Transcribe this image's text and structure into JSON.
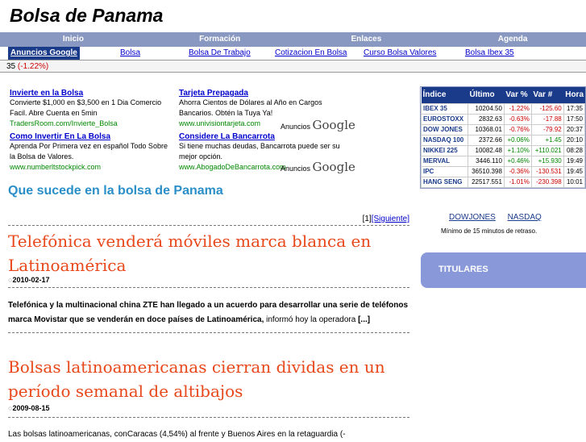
{
  "site_title": "Bolsa de Panama",
  "nav": [
    "Inicio",
    "Formación",
    "Enlaces",
    "Agenda"
  ],
  "subnav": {
    "ad_label": "Anuncios Google",
    "links": [
      "Bolsa",
      "Bolsa De Trabajo",
      "Cotizacion En Bolsa",
      "Curso Bolsa Valores",
      "Bolsa Ibex 35"
    ]
  },
  "ticker": {
    "prefix": "35",
    "value": "(-1.22%)"
  },
  "ads": [
    {
      "title": "Invierte en la Bolsa",
      "body": "Convierte $1,000 en $3,500 en 1 Dia Comercio Facil. Abre Cuenta en 5min",
      "url": "TradersRoom.com/Invierte_Bolsa"
    },
    {
      "title": "Tarjeta Prepagada",
      "body": "Ahorra Cientos de Dólares al Año en Cargos Bancarios. Obtén la Tuya Ya!",
      "url": "www.univisiontarjeta.com"
    },
    {
      "title": "Como Invertir En La Bolsa",
      "body": "Aprenda Por Primera vez en español Todo Sobre la Bolsa de Valores.",
      "url": "www.numberltstockpick.com"
    },
    {
      "title": "Considere La Bancarrota",
      "body": "Si tiene muchas deudas, Bancarrota puede ser su mejor opción.",
      "url": "www.AbogadoDeBancarrota.com"
    }
  ],
  "ads_by": {
    "label": "Anuncios",
    "brand": "Google"
  },
  "section_title": "Que sucede en la bolsa de Panama",
  "pager": {
    "current": "[1]",
    "next": "[Siguiente]"
  },
  "articles": [
    {
      "title": "Telefónica venderá móviles marca blanca en Latinoamérica",
      "date": "2010-02-17",
      "body_bold": "Telefónica y la multinacional china ZTE han llegado a un acuerdo para desarrollar una serie de teléfonos marca Movistar que se venderán en doce países de Latinoamérica,",
      "body_rest": " informó hoy la operadora ",
      "more": "[...]"
    },
    {
      "title": "Bolsas latinoamericanas cierran dividas en un período semanal de altibajos",
      "date": "2009-08-15",
      "body_rest": "Las bolsas latinoamericanas, conCaracas (4,54%) al frente y Buenos Aires en la retaguardia (-"
    }
  ],
  "market": {
    "headers": [
      "Índice",
      "Último",
      "Var %",
      "Var #",
      "Hora"
    ],
    "rows": [
      [
        "IBEX 35",
        "10204.50",
        "-1.22%",
        "-125.60",
        "17:35"
      ],
      [
        "EUROSTOXX",
        "2832.63",
        "-0.63%",
        "-17.88",
        "17:50"
      ],
      [
        "DOW JONES",
        "10368.01",
        "-0.76%",
        "-79.92",
        "20:37"
      ],
      [
        "NASDAQ 100",
        "2372.66",
        "+0.06%",
        "+1.45",
        "20:10"
      ],
      [
        "NIKKEI 225",
        "10082.48",
        "+1.10%",
        "+110.021",
        "08:28"
      ],
      [
        "MERVAL",
        "3446.110",
        "+0.46%",
        "+15.930",
        "19:49"
      ],
      [
        "IPC",
        "36510.398",
        "-0.36%",
        "-130.531",
        "19:45"
      ],
      [
        "HANG SENG",
        "22517.551",
        "-1.01%",
        "-230.398",
        "10:01"
      ]
    ]
  },
  "index_links": [
    "DOWJONES",
    "NASDAQ"
  ],
  "delay_note": "Mínimo de 15 minutos de retraso.",
  "titulares": "TITULARES",
  "colors": {
    "nav": "#8898c0",
    "accent": "#e8471a",
    "section": "#2a8fc8"
  }
}
